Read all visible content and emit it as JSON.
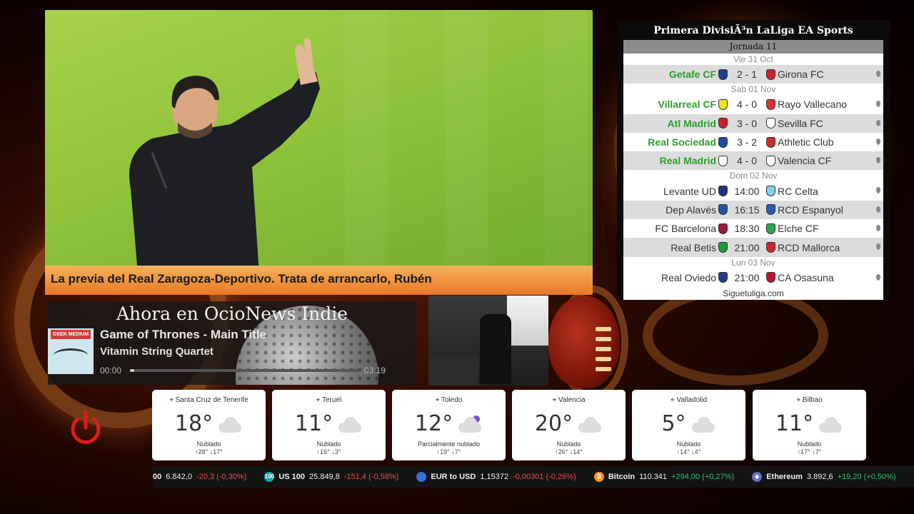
{
  "news": {
    "caption": "La previa del Real Zaragoza-Deportivo. Trata de arrancarlo, Rubén"
  },
  "liga": {
    "title": "Primera DivisiÃ³n LaLiga EA Sports",
    "jornada": "Jornada 11",
    "days": [
      "Vie 31 Oct",
      "Sab 01 Nov",
      "Dom 02 Nov",
      "Lun 03 Nov"
    ],
    "matches": [
      {
        "home": "Getafe CF",
        "score": "2 - 1",
        "away": "Girona FC",
        "home_color": "#1d3d8f",
        "away_color": "#d0202a"
      },
      {
        "home": "Villarreal CF",
        "score": "4 - 0",
        "away": "Rayo Vallecano",
        "home_color": "#f2e21c",
        "away_color": "#e23030"
      },
      {
        "home": "Atl Madrid",
        "score": "3 - 0",
        "away": "Sevilla FC",
        "home_color": "#d21f27",
        "away_color": "#ffffff"
      },
      {
        "home": "Real Sociedad",
        "score": "3 - 2",
        "away": "Athletic Club",
        "home_color": "#1a49a8",
        "away_color": "#d22a2a"
      },
      {
        "home": "Real Madrid",
        "score": "4 - 0",
        "away": "Valencia CF",
        "home_color": "#ffffff",
        "away_color": "#ffffff"
      },
      {
        "home": "Levante UD",
        "score": "14:00",
        "away": "RC Celta",
        "home_color": "#1c2f86",
        "away_color": "#7fd0e8"
      },
      {
        "home": "Dep Alavés",
        "score": "16:15",
        "away": "RCD Espanyol",
        "home_color": "#2150a8",
        "away_color": "#2958b8"
      },
      {
        "home": "FC Barcelona",
        "score": "18:30",
        "away": "Elche CF",
        "home_color": "#a3153b",
        "away_color": "#2aa54a"
      },
      {
        "home": "Real Betis",
        "score": "21:00",
        "away": "RCD Mallorca",
        "home_color": "#1f9a3c",
        "away_color": "#d21f27"
      },
      {
        "home": "Real Oviedo",
        "score": "21:00",
        "away": "CA Osasuna",
        "home_color": "#1d3d8f",
        "away_color": "#c8102e"
      }
    ],
    "site": "Siguetuliga.com"
  },
  "player": {
    "header": "Ahora en OcioNews Indie",
    "cover_text": "GEEK MEDIUM",
    "track": "Game of Thrones - Main Title",
    "artist": "Vitamin String Quartet",
    "time_start": "00:00",
    "time_end": "03:19",
    "progress": 0.02
  },
  "weather": [
    {
      "city": "Santa Cruz de Tenerife",
      "temp": "18°",
      "desc": "Nublado",
      "range": "↑28°  ↓17°",
      "icon": "cloud-icon"
    },
    {
      "city": "Teruel",
      "temp": "11°",
      "desc": "Nublado",
      "range": "↑16°  ↓3°",
      "icon": "cloud-icon"
    },
    {
      "city": "Toledo",
      "temp": "12°",
      "desc": "Parcialmente nublado",
      "range": "↑19°  ↓7°",
      "icon": "partly-cloudy-night-icon"
    },
    {
      "city": "Valencia",
      "temp": "20°",
      "desc": "Nublado",
      "range": "↑26°  ↓14°",
      "icon": "cloud-icon"
    },
    {
      "city": "Valladolid",
      "temp": "5°",
      "desc": "Nublado",
      "range": "↑14°  ↓4°",
      "icon": "cloud-icon"
    },
    {
      "city": "Bilbao",
      "temp": "11°",
      "desc": "Nublado",
      "range": "↑17°  ↓7°",
      "icon": "cloud-icon"
    }
  ],
  "ticker": [
    {
      "name": "00",
      "value": "6.842,0",
      "change": "-20,3 (-0,30%)",
      "dir": "neg",
      "icon_color": ""
    },
    {
      "name": "US 100",
      "value": "25.849,8",
      "change": "-151,4 (-0,58%)",
      "dir": "neg",
      "icon_color": "#1aa5a5",
      "icon_text": "100"
    },
    {
      "name": "EUR to USD",
      "value": "1,15372",
      "change": "-0,00301 (-0,26%)",
      "dir": "neg",
      "icon_color": "#3b6fd8"
    },
    {
      "name": "Bitcoin",
      "value": "110.341",
      "change": "+294,00 (+0,27%)",
      "dir": "pos",
      "icon_color": "#f7931a"
    },
    {
      "name": "Ethereum",
      "value": "3.892,6",
      "change": "+19,20 (+0,50%)",
      "dir": "pos",
      "icon_color": "#6270c8"
    }
  ],
  "colors": {
    "accent": "#e8782a",
    "win": "#2e9d2e",
    "power": "#d91c1c"
  }
}
